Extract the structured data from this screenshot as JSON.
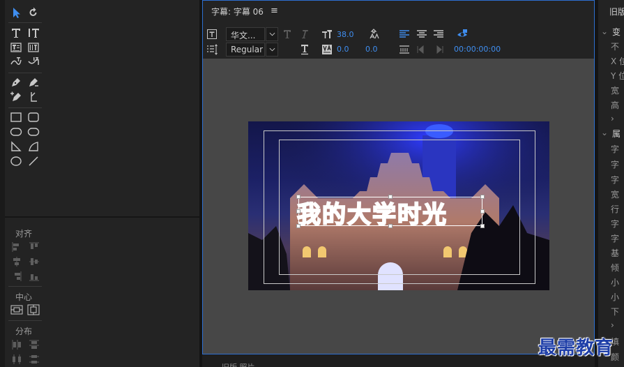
{
  "left_panel": {
    "align_label": "对齐",
    "center_label": "中心",
    "distribute_label": "分布"
  },
  "title_panel": {
    "tab_title": "字幕: 字幕 06",
    "menu_icon": "hamburger-icon",
    "font_family": "华文...",
    "font_style": "Regular",
    "font_size": "38.0",
    "kerning": "0.0",
    "leading": "0.0",
    "timecode": "00:00:00:00",
    "caption_text": "我的大学时光",
    "accent_color": "#3f8ef0",
    "caption_fill": "#3b3bff",
    "caption_stroke": "#ffffff"
  },
  "right_panel": {
    "header": "旧版",
    "items": [
      "变",
      "不",
      "X 位",
      "Y 位",
      "宽",
      "高",
      "›",
      "属",
      "字",
      "字",
      "字",
      "宽",
      "行",
      "字",
      "字",
      "基",
      "倾",
      "小",
      "小",
      "下",
      "›",
      "填",
      "颜"
    ]
  },
  "bottom": {
    "text": "旧版 照片"
  },
  "watermark": {
    "text": "最需教育"
  }
}
